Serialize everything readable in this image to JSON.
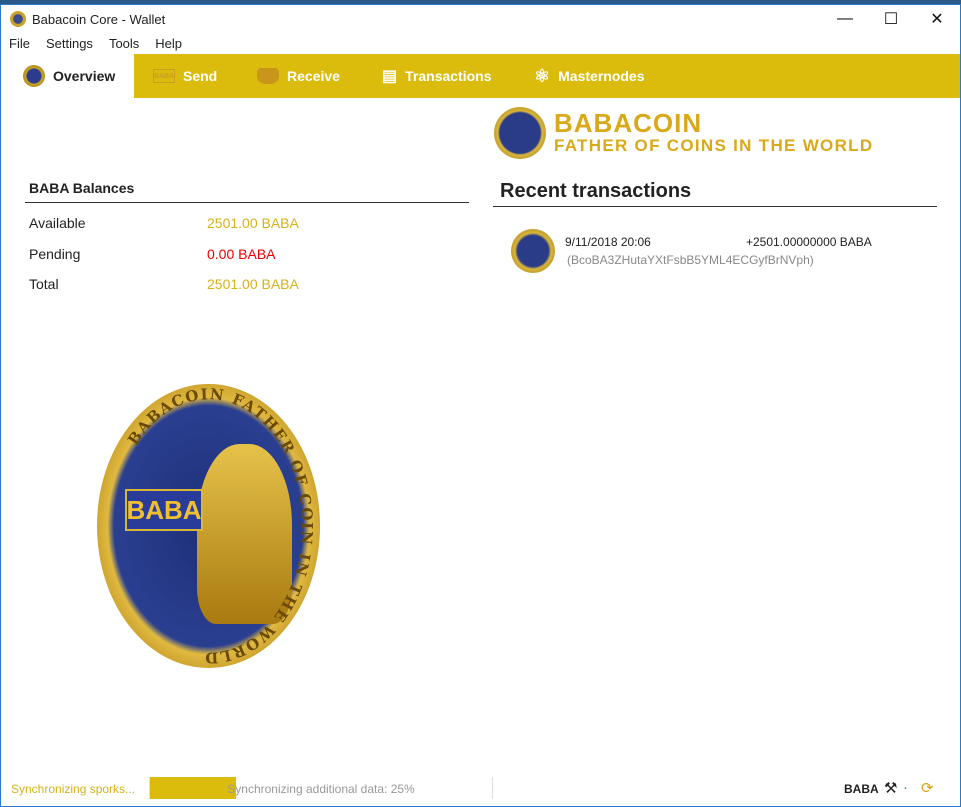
{
  "window": {
    "title": "Babacoin Core - Wallet",
    "minimize": "—",
    "maximize": "☐",
    "close": "✕"
  },
  "menu": [
    "File",
    "Settings",
    "Tools",
    "Help"
  ],
  "tabs": [
    {
      "label": "Overview",
      "icon": "coin-icon"
    },
    {
      "label": "Send",
      "icon": "send-icon"
    },
    {
      "label": "Receive",
      "icon": "receive-icon"
    },
    {
      "label": "Transactions",
      "icon": "transactions-icon"
    },
    {
      "label": "Masternodes",
      "icon": "atom-icon"
    }
  ],
  "balances": {
    "title": "BABA Balances",
    "available_label": "Available",
    "available": "2501.00 BABA",
    "pending_label": "Pending",
    "pending": "0.00 BABA",
    "total_label": "Total",
    "total": "2501.00 BABA"
  },
  "logo": {
    "name": "BABACOIN",
    "tagline": "FATHER OF COINS IN THE WORLD"
  },
  "coin_art": {
    "banner": "BABA",
    "ring_text": "BABACOIN FATHER OF COIN IN THE WORLD"
  },
  "recent": {
    "title": "Recent transactions",
    "items": [
      {
        "date": "9/11/2018 20:06",
        "amount": "+2501.00000000 BABA",
        "address": "(BcoBA3ZHutaYXtFsbB5YML4ECGyfBrNVph)"
      }
    ]
  },
  "status": {
    "sync_text": "Synchronizing sporks...",
    "progress_text": "Synchronizing additional data: 25%",
    "progress": 25,
    "unit": "BABA"
  },
  "colors": {
    "accent": "#dbbc0c",
    "negative": "#ee0000"
  }
}
